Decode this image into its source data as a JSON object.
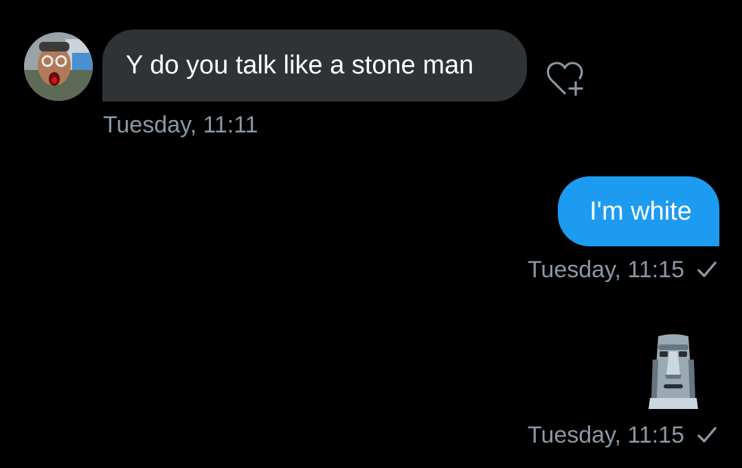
{
  "conversation": {
    "messages": [
      {
        "direction": "incoming",
        "text": "Y do you talk like a stone man",
        "timestamp": "Tuesday, 11:11",
        "actions": {
          "like_icon": "heart-plus-icon"
        }
      },
      {
        "direction": "outgoing",
        "text": "I'm white",
        "timestamp": "Tuesday, 11:15",
        "status_icon": "checkmark-icon"
      },
      {
        "direction": "outgoing",
        "emoji": "moai-emoji",
        "timestamp": "Tuesday, 11:15",
        "status_icon": "checkmark-icon"
      }
    ]
  },
  "colors": {
    "background": "#000000",
    "incoming_bubble": "#2f3336",
    "outgoing_bubble": "#1d9bf0",
    "timestamp": "#8b98a5",
    "text": "#ffffff"
  }
}
